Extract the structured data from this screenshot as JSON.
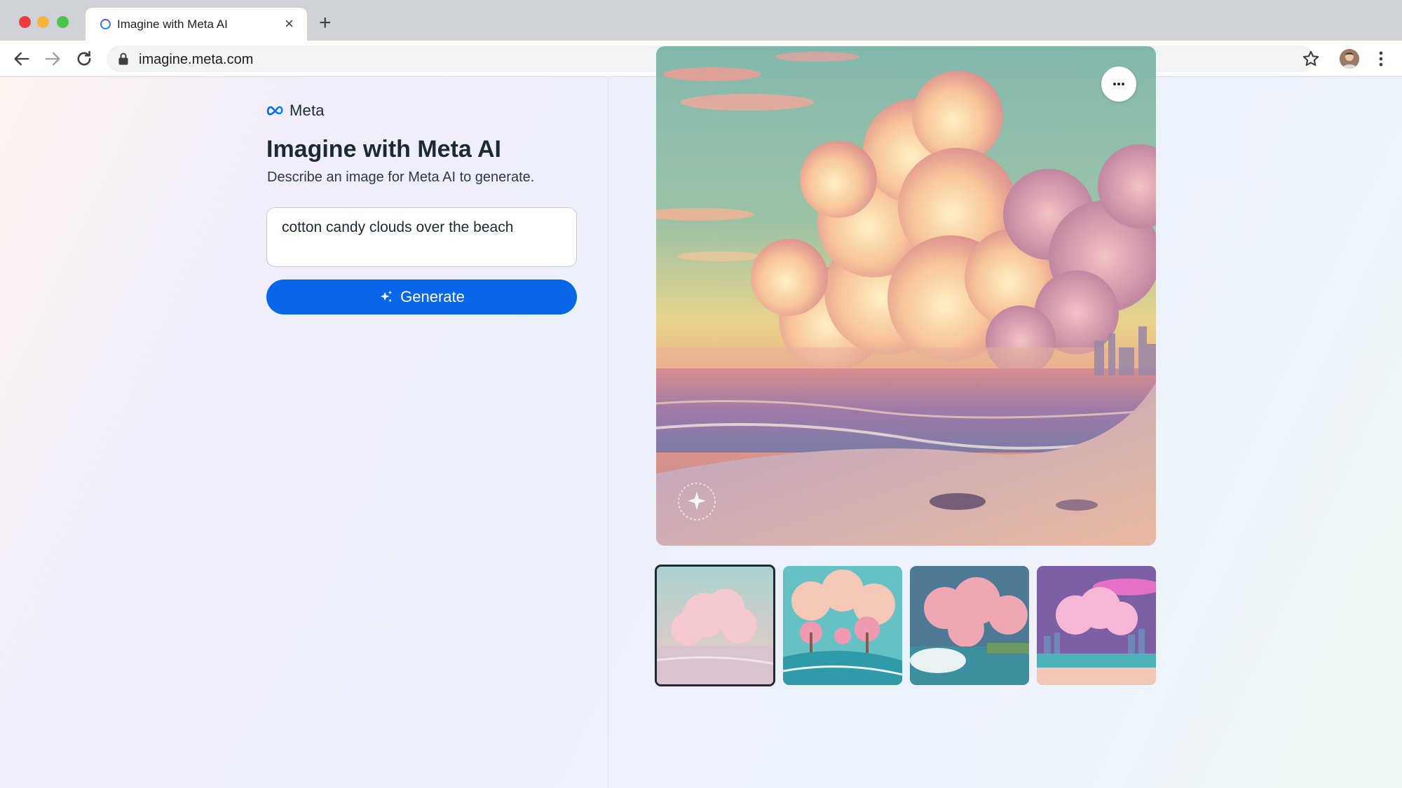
{
  "browser": {
    "tab_title": "Imagine with Meta AI",
    "url": "imagine.meta.com",
    "icons": [
      "back-arrow-icon",
      "forward-arrow-icon",
      "reload-icon",
      "lock-icon",
      "star-icon",
      "kebab-menu-icon",
      "close-icon",
      "plus-icon"
    ]
  },
  "header": {
    "logo_text": "Meta"
  },
  "main": {
    "title": "Imagine with Meta AI",
    "subtitle": "Describe an image for Meta AI to generate.",
    "prompt_value": "cotton candy clouds over the beach",
    "generate_label": "Generate"
  },
  "gallery": {
    "selected_index": 0,
    "thumbnail_count": 4
  },
  "colors": {
    "primary_button": "#0866e8",
    "title_text": "#1c2b33"
  }
}
